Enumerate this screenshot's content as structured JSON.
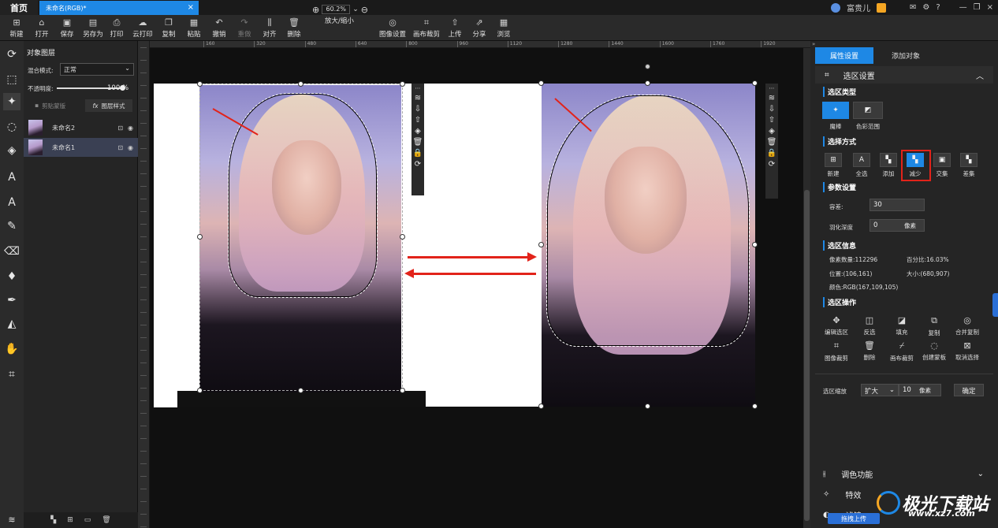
{
  "titlebar": {
    "home_tab": "首页",
    "doc_tab": "未命名(RGB)*",
    "user_name": "富贵儿"
  },
  "toolbar": {
    "buttons": [
      {
        "label": "新建",
        "icon": "new-icon",
        "glyph": "⊞"
      },
      {
        "label": "打开",
        "icon": "folder-open-icon",
        "glyph": "⌂"
      },
      {
        "label": "保存",
        "icon": "save-icon",
        "glyph": "▣"
      },
      {
        "label": "另存为",
        "icon": "save-as-icon",
        "glyph": "▤"
      },
      {
        "label": "打印",
        "icon": "print-icon",
        "glyph": "⎙"
      },
      {
        "label": "云打印",
        "icon": "cloud-print-icon",
        "glyph": "☁"
      },
      {
        "label": "复制",
        "icon": "copy-icon",
        "glyph": "❐"
      },
      {
        "label": "粘贴",
        "icon": "paste-icon",
        "glyph": "▦"
      },
      {
        "label": "撤销",
        "icon": "undo-icon",
        "glyph": "↶"
      },
      {
        "label": "重做",
        "icon": "redo-icon",
        "glyph": "↷",
        "disabled": true
      },
      {
        "label": "对齐",
        "icon": "align-icon",
        "glyph": "⫼"
      },
      {
        "label": "删除",
        "icon": "delete-icon",
        "glyph": "🗑"
      }
    ],
    "zoom_value": "60.2%",
    "zoom_label": "放大/缩小",
    "buttons2": [
      {
        "label": "图像设置",
        "icon": "image-settings-icon",
        "glyph": "◎"
      },
      {
        "label": "画布裁剪",
        "icon": "canvas-crop-icon",
        "glyph": "⌗"
      },
      {
        "label": "上传",
        "icon": "upload-icon",
        "glyph": "⇧"
      },
      {
        "label": "分享",
        "icon": "share-icon",
        "glyph": "⇗"
      },
      {
        "label": "浏览",
        "icon": "browse-icon",
        "glyph": "▦"
      }
    ]
  },
  "layers": {
    "title": "对象图层",
    "blend_label": "混合模式:",
    "blend_value": "正常",
    "opacity_label": "不透明度:",
    "opacity_value": "100",
    "opacity_unit": "%",
    "opacity": 1.0,
    "clip_mask": "剪贴蒙版",
    "layer_style": "图层样式",
    "items": [
      {
        "name": "未命名2"
      },
      {
        "name": "未命名1"
      }
    ]
  },
  "ruler": {
    "ticks": [
      "160",
      "320",
      "480",
      "640",
      "800",
      "960",
      "1120",
      "1280",
      "1440",
      "1600",
      "1760",
      "1920"
    ]
  },
  "right_panel": {
    "tabs": [
      "属性设置",
      "添加对象"
    ],
    "section": "选区设置",
    "select_type": {
      "title": "选区类型",
      "items": [
        "魔棒",
        "色彩范围"
      ]
    },
    "select_mode": {
      "title": "选择方式",
      "items": [
        "新建",
        "全选",
        "添加",
        "减少",
        "交集",
        "差集"
      ],
      "active": "减少"
    },
    "params": {
      "title": "参数设置",
      "tolerance_label": "容差:",
      "tolerance": "30",
      "feather_label": "羽化深度",
      "feather": "0",
      "feather_unit": "像素"
    },
    "info": {
      "title": "选区信息",
      "pixels": "像素数量:112296",
      "percent": "百分比:16.03%",
      "position": "位置:(106,161)",
      "size": "大小:(680,907)",
      "color": "颜色:RGB(167,109,105)"
    },
    "ops": {
      "title": "选区操作",
      "row1": [
        "编辑选区",
        "反选",
        "填充",
        "复制",
        "合并复制"
      ],
      "row2": [
        "图像裁剪",
        "删除",
        "画布裁剪",
        "创建蒙板",
        "取消选择"
      ]
    },
    "zoom": {
      "label": "选区缩放",
      "mode": "扩大",
      "value": "10",
      "unit": "像素",
      "confirm": "确定"
    },
    "collapsed": [
      "调色功能",
      "特效",
      "滤镜"
    ]
  },
  "watermark": {
    "title": "极光下载站",
    "url": "www.xz7.com",
    "upload": "拖拽上传"
  },
  "colors": {
    "accent": "#1e88e5",
    "annotation": "#e2231a"
  }
}
